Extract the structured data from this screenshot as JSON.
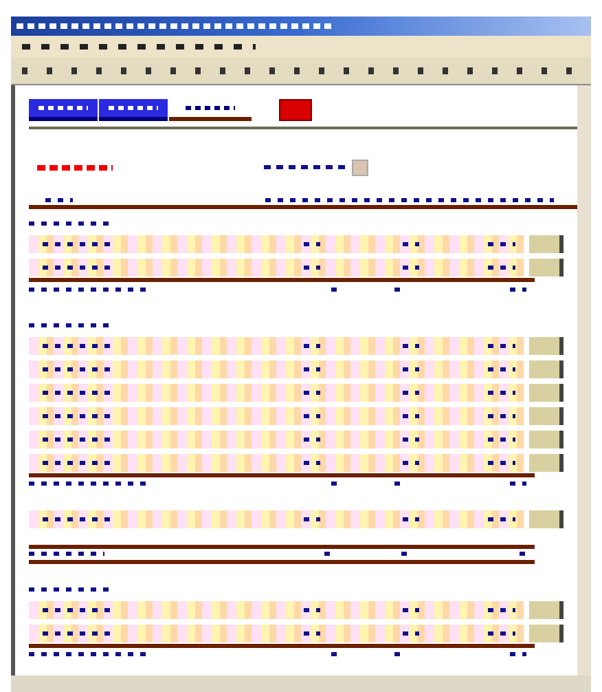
{
  "nav_tabs": [
    {
      "selected": true
    },
    {
      "selected": true
    },
    {
      "selected": false
    }
  ],
  "blocks": [
    {
      "kind": "header"
    },
    {
      "kind": "heading"
    },
    {
      "kind": "row"
    },
    {
      "kind": "row"
    },
    {
      "kind": "total"
    },
    {
      "kind": "heading"
    },
    {
      "kind": "row"
    },
    {
      "kind": "row"
    },
    {
      "kind": "row"
    },
    {
      "kind": "row"
    },
    {
      "kind": "row"
    },
    {
      "kind": "row"
    },
    {
      "kind": "total"
    },
    {
      "kind": "row"
    },
    {
      "kind": "grand_total"
    },
    {
      "kind": "heading"
    },
    {
      "kind": "row"
    },
    {
      "kind": "row"
    },
    {
      "kind": "total"
    }
  ]
}
